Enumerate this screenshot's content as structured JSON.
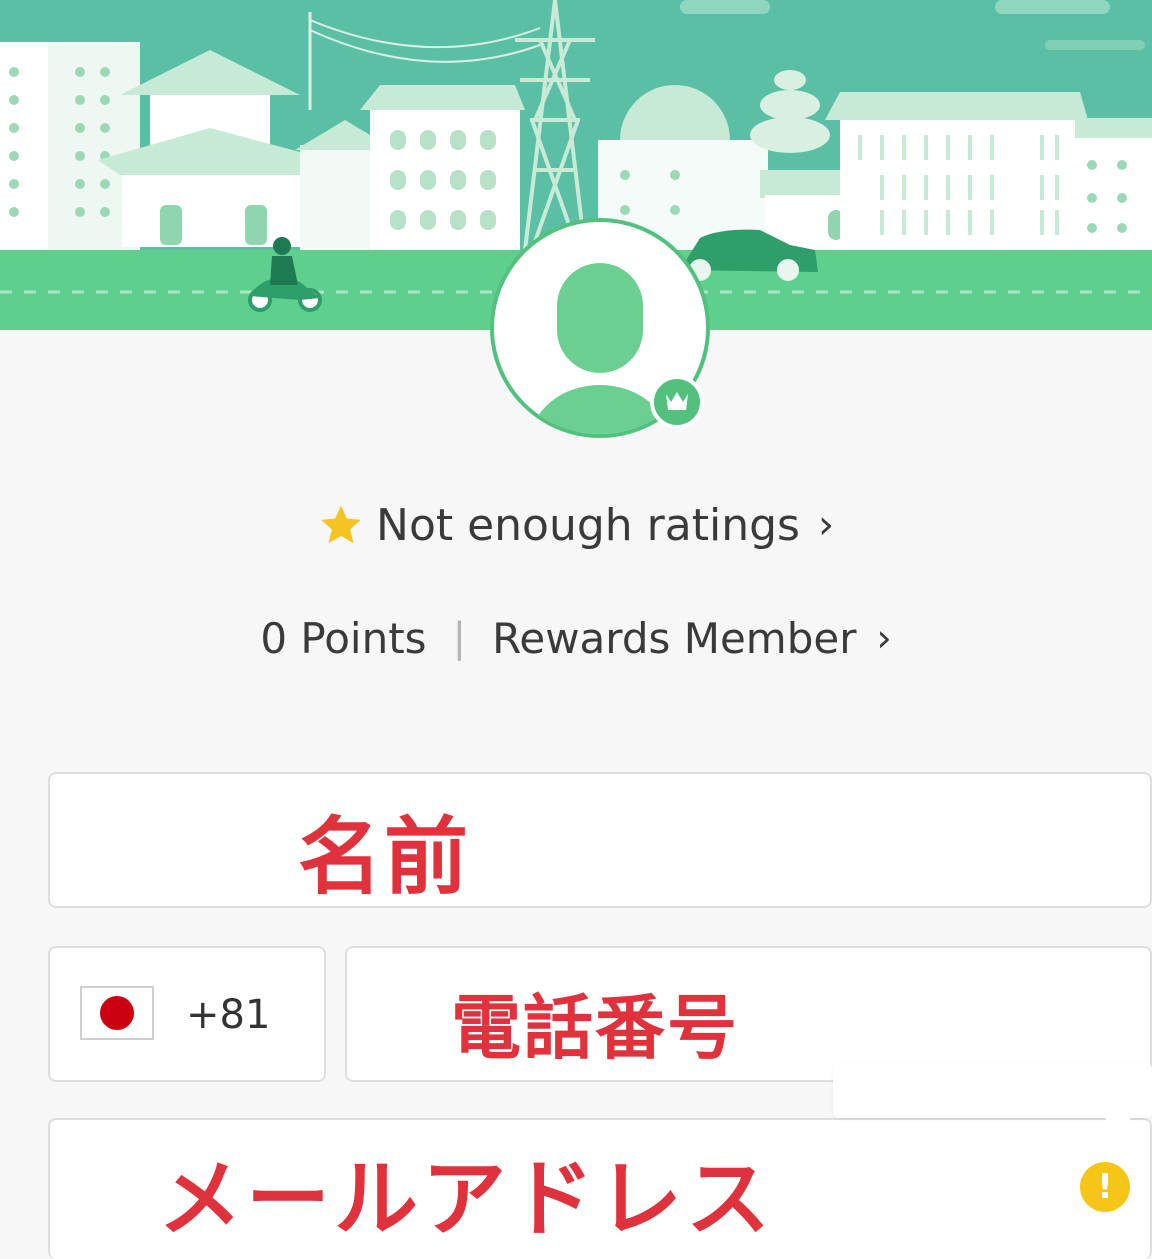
{
  "profile": {
    "rating_text": "Not enough ratings",
    "rating_chevron": "›",
    "points_text": "0 Points",
    "separator": "|",
    "tier_text": "Rewards Member",
    "tier_chevron": "›"
  },
  "form": {
    "name_overlay": "名前",
    "country_code": "+81",
    "phone_overlay": "電話番号",
    "email_overlay": "メールアドレス",
    "warning_glyph": "!"
  },
  "icons": {
    "rating": "star-icon",
    "badge": "crown-icon",
    "warning": "warning-icon",
    "flag": "japan-flag-icon"
  },
  "colors": {
    "banner_sky": "#5bbfa6",
    "road": "#5ecf8d",
    "accent": "#52c17e",
    "star": "#f6c325",
    "overlay_text": "#e0323c",
    "warning": "#f5c518",
    "flag_red": "#cc0011"
  }
}
